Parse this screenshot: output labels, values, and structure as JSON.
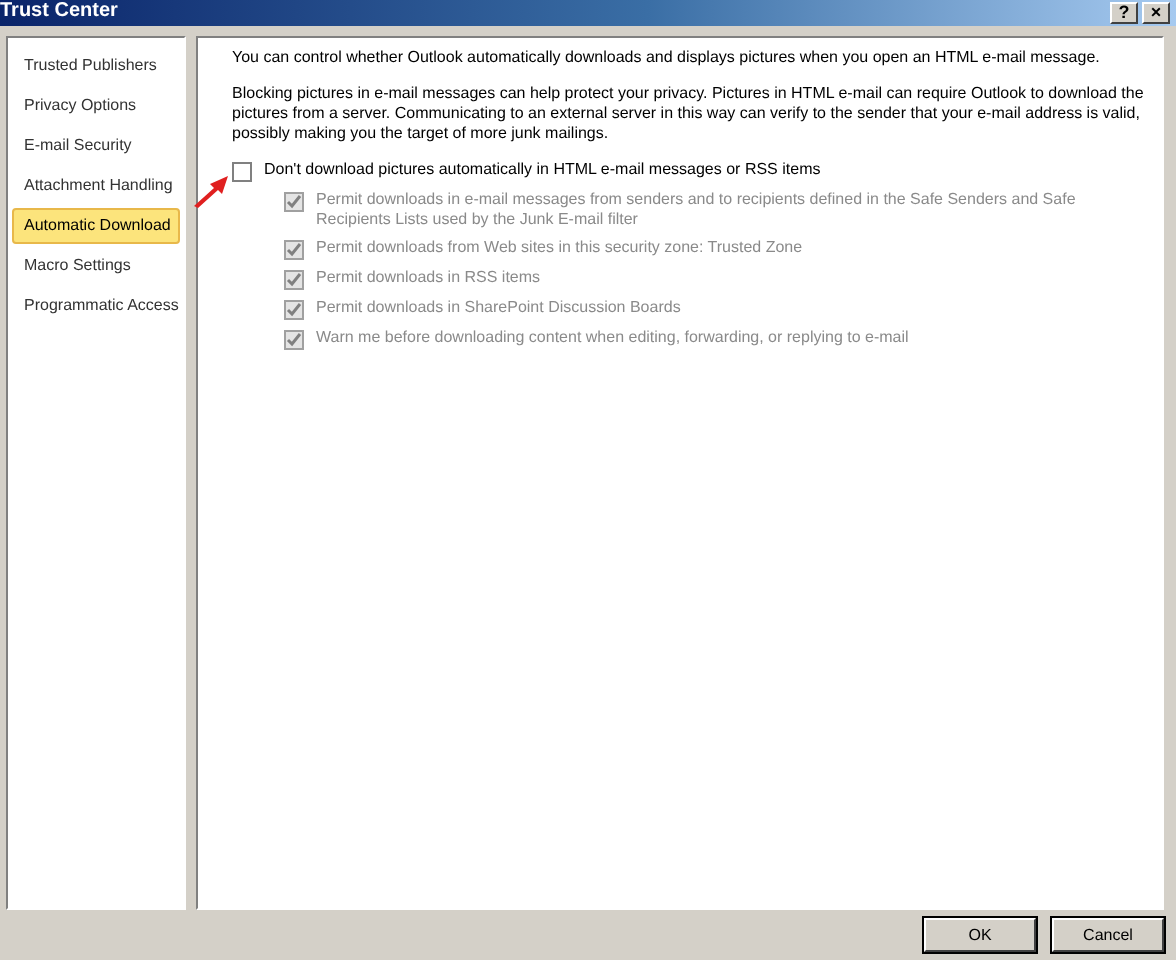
{
  "window": {
    "title": "Trust Center",
    "help": "?",
    "close": "×"
  },
  "sidebar": {
    "items": [
      {
        "label": "Trusted Publishers",
        "selected": false
      },
      {
        "label": "Privacy Options",
        "selected": false
      },
      {
        "label": "E-mail Security",
        "selected": false
      },
      {
        "label": "Attachment Handling",
        "selected": false
      },
      {
        "label": "Automatic Download",
        "selected": true
      },
      {
        "label": "Macro Settings",
        "selected": false
      },
      {
        "label": "Programmatic Access",
        "selected": false
      }
    ]
  },
  "intro": "You can control whether Outlook automatically downloads and displays pictures when you open an HTML e-mail message.",
  "explanation": "Blocking pictures in e-mail messages can help protect your privacy. Pictures in HTML e-mail can require Outlook to download the pictures from a server. Communicating to an external server in this way can verify to the sender that your e-mail address is valid, possibly making you the target of more junk mailings.",
  "main_option": {
    "label": "Don't download pictures automatically in HTML e-mail messages or RSS items",
    "checked": false
  },
  "sub_options": [
    {
      "label": "Permit downloads in e-mail messages from senders and to recipients defined in the Safe Senders and Safe Recipients Lists used by the Junk E-mail filter",
      "checked": true,
      "disabled": true
    },
    {
      "label": "Permit downloads from Web sites in this security zone: Trusted Zone",
      "checked": true,
      "disabled": true
    },
    {
      "label": "Permit downloads in RSS items",
      "checked": true,
      "disabled": true
    },
    {
      "label": "Permit downloads in SharePoint Discussion Boards",
      "checked": true,
      "disabled": true
    },
    {
      "label": "Warn me before downloading content when editing, forwarding, or replying to e-mail",
      "checked": true,
      "disabled": true
    }
  ],
  "buttons": [
    "OK",
    "Cancel"
  ]
}
